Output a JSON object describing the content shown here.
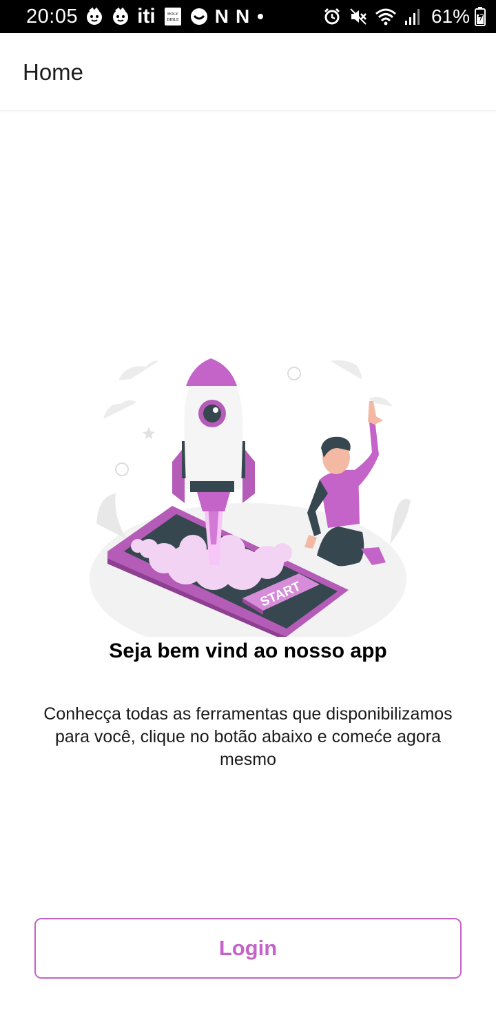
{
  "status_bar": {
    "time": "20:05",
    "battery": "61%",
    "icons_left": [
      "kid-face-icon",
      "kid-face-icon",
      "iti-app-icon",
      "holy-bible-icon",
      "face-icon",
      "netflix-icon",
      "netflix-icon",
      "dot-icon"
    ],
    "icons_right": [
      "alarm-icon",
      "mute-icon",
      "wifi-icon",
      "signal-icon",
      "battery-icon"
    ],
    "iti_text": "iti",
    "n_letter": "N",
    "bible_text": "HOLY BIBLE"
  },
  "app_bar": {
    "title": "Home"
  },
  "main": {
    "illustration": {
      "start_label": "START"
    },
    "title": "Seja bem vind ao nosso app",
    "description": "Conhecça todas as ferramentas que disponibilizamos para você, clique no botão abaixo e comeće agora mesmo"
  },
  "login_button": {
    "label": "Login"
  },
  "colors": {
    "accent": "#c463c8",
    "dark_teal": "#37474f"
  }
}
